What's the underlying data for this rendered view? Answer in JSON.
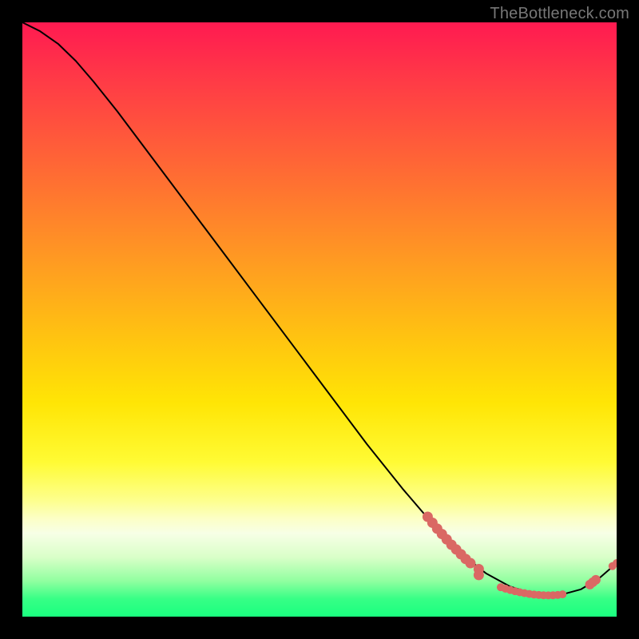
{
  "watermark": "TheBottleneck.com",
  "chart_data": {
    "type": "line",
    "title": "",
    "xlabel": "",
    "ylabel": "",
    "xlim": [
      0,
      100
    ],
    "ylim": [
      0,
      100
    ],
    "grid": false,
    "legend": false,
    "series": [
      {
        "name": "curve",
        "x": [
          0,
          3,
          6,
          9,
          12,
          16,
          22,
          28,
          34,
          40,
          46,
          52,
          58,
          64,
          70,
          74,
          78,
          82,
          86,
          90,
          94,
          97,
          100
        ],
        "y": [
          100,
          98.5,
          96.4,
          93.5,
          90,
          85,
          77,
          69,
          61,
          53,
          45,
          37,
          29,
          21.5,
          14.5,
          10.5,
          7.3,
          5.1,
          3.8,
          3.5,
          4.6,
          6.4,
          9.0
        ]
      }
    ],
    "markers": [
      {
        "name": "cluster-left-descent",
        "color": "#da6864",
        "radius_px": 6.5,
        "points": [
          {
            "x": 68.2,
            "y": 16.8
          },
          {
            "x": 69.0,
            "y": 15.8
          },
          {
            "x": 69.8,
            "y": 14.8
          },
          {
            "x": 70.6,
            "y": 13.9
          },
          {
            "x": 71.4,
            "y": 13.0
          },
          {
            "x": 72.2,
            "y": 12.1
          },
          {
            "x": 73.0,
            "y": 11.3
          },
          {
            "x": 73.8,
            "y": 10.5
          },
          {
            "x": 74.6,
            "y": 9.7
          },
          {
            "x": 75.4,
            "y": 9.0
          }
        ]
      },
      {
        "name": "cluster-stacked-double",
        "color": "#da6864",
        "radius_px": 6.5,
        "points": [
          {
            "x": 76.8,
            "y": 8.0
          },
          {
            "x": 76.8,
            "y": 7.0
          }
        ]
      },
      {
        "name": "cluster-trough",
        "color": "#da6864",
        "radius_px": 5.0,
        "points": [
          {
            "x": 80.5,
            "y": 4.95
          },
          {
            "x": 81.3,
            "y": 4.7
          },
          {
            "x": 82.1,
            "y": 4.48
          },
          {
            "x": 82.9,
            "y": 4.28
          },
          {
            "x": 83.7,
            "y": 4.1
          },
          {
            "x": 84.5,
            "y": 3.95
          },
          {
            "x": 85.3,
            "y": 3.82
          },
          {
            "x": 86.1,
            "y": 3.72
          },
          {
            "x": 86.9,
            "y": 3.65
          },
          {
            "x": 87.7,
            "y": 3.6
          },
          {
            "x": 88.5,
            "y": 3.58
          },
          {
            "x": 89.3,
            "y": 3.6
          },
          {
            "x": 90.1,
            "y": 3.65
          },
          {
            "x": 90.9,
            "y": 3.75
          }
        ]
      },
      {
        "name": "cluster-right-ascent",
        "color": "#da6864",
        "radius_px": 6.0,
        "points": [
          {
            "x": 95.5,
            "y": 5.4
          },
          {
            "x": 96.0,
            "y": 5.8
          },
          {
            "x": 96.5,
            "y": 6.2
          }
        ]
      },
      {
        "name": "cluster-top-right",
        "color": "#da6864",
        "radius_px": 5.0,
        "points": [
          {
            "x": 99.3,
            "y": 8.5
          },
          {
            "x": 100.0,
            "y": 9.0
          }
        ]
      }
    ]
  }
}
